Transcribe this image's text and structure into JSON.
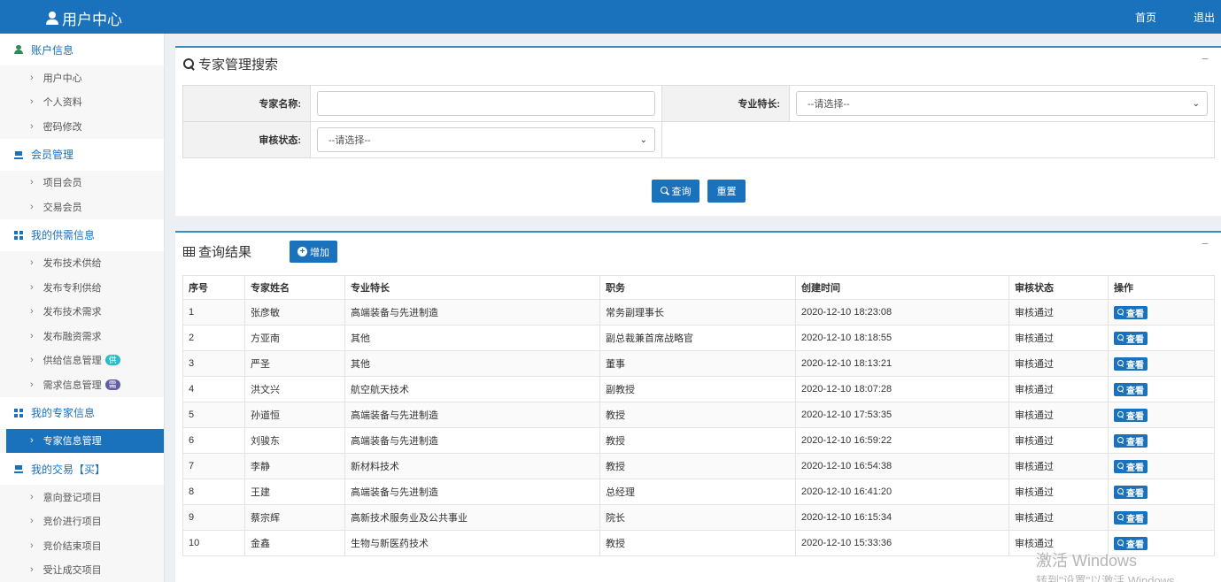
{
  "header": {
    "title": "用户中心",
    "home": "首页",
    "logout": "退出"
  },
  "sidebar": {
    "groups": [
      {
        "title": "账户信息",
        "icon": "user-icon",
        "items": [
          "用户中心",
          "个人资料",
          "密码修改"
        ]
      },
      {
        "title": "会员管理",
        "icon": "cart-icon",
        "items": [
          "项目会员",
          "交易会员"
        ]
      },
      {
        "title": "我的供需信息",
        "icon": "windows-icon",
        "items": [
          "发布技术供给",
          "发布专利供给",
          "发布技术需求",
          "发布融资需求",
          "供给信息管理",
          "需求信息管理"
        ],
        "badges": {
          "供给信息管理": "供",
          "需求信息管理": "需"
        }
      },
      {
        "title": "我的专家信息",
        "icon": "windows-icon",
        "items": [
          "专家信息管理"
        ],
        "active": "专家信息管理"
      },
      {
        "title": "我的交易【买】",
        "icon": "cart-icon",
        "items": [
          "意向登记项目",
          "竞价进行项目",
          "竞价结束项目",
          "受让成交项目"
        ]
      }
    ]
  },
  "search": {
    "title": "专家管理搜索",
    "collapse": "−",
    "name_label": "专家名称:",
    "name_value": "",
    "specialty_label": "专业特长:",
    "specialty_value": "--请选择--",
    "status_label": "审核状态:",
    "status_value": "--请选择--",
    "query_button": "查询",
    "reset_button": "重置"
  },
  "results": {
    "title": "查询结果",
    "collapse": "−",
    "add_button": "增加",
    "columns": [
      "序号",
      "专家姓名",
      "专业特长",
      "职务",
      "创建时间",
      "审核状态",
      "操作"
    ],
    "view_label": "查看",
    "rows": [
      [
        "1",
        "张彦敏",
        "高端装备与先进制造",
        "常务副理事长",
        "2020-12-10 18:23:08",
        "审核通过"
      ],
      [
        "2",
        "方亚南",
        "其他",
        "副总裁兼首席战略官",
        "2020-12-10 18:18:55",
        "审核通过"
      ],
      [
        "3",
        "严圣",
        "其他",
        "董事",
        "2020-12-10 18:13:21",
        "审核通过"
      ],
      [
        "4",
        "洪文兴",
        "航空航天技术",
        "副教授",
        "2020-12-10 18:07:28",
        "审核通过"
      ],
      [
        "5",
        "孙道恒",
        "高端装备与先进制造",
        "教授",
        "2020-12-10 17:53:35",
        "审核通过"
      ],
      [
        "6",
        "刘骏东",
        "高端装备与先进制造",
        "教授",
        "2020-12-10 16:59:22",
        "审核通过"
      ],
      [
        "7",
        "李静",
        "新材料技术",
        "教授",
        "2020-12-10 16:54:38",
        "审核通过"
      ],
      [
        "8",
        "王建",
        "高端装备与先进制造",
        "总经理",
        "2020-12-10 16:41:20",
        "审核通过"
      ],
      [
        "9",
        "蔡宗辉",
        "高新技术服务业及公共事业",
        "院长",
        "2020-12-10 16:15:34",
        "审核通过"
      ],
      [
        "10",
        "金鑫",
        "生物与新医药技术",
        "教授",
        "2020-12-10 15:33:36",
        "审核通过"
      ]
    ]
  },
  "watermark": {
    "line1": "激活 Windows",
    "line2": "转到\"设置\"以激活 Windows。"
  },
  "colors": {
    "primary": "#1a72bd",
    "badge_supply": "#2bbbc8",
    "badge_demand": "#605ca8"
  }
}
